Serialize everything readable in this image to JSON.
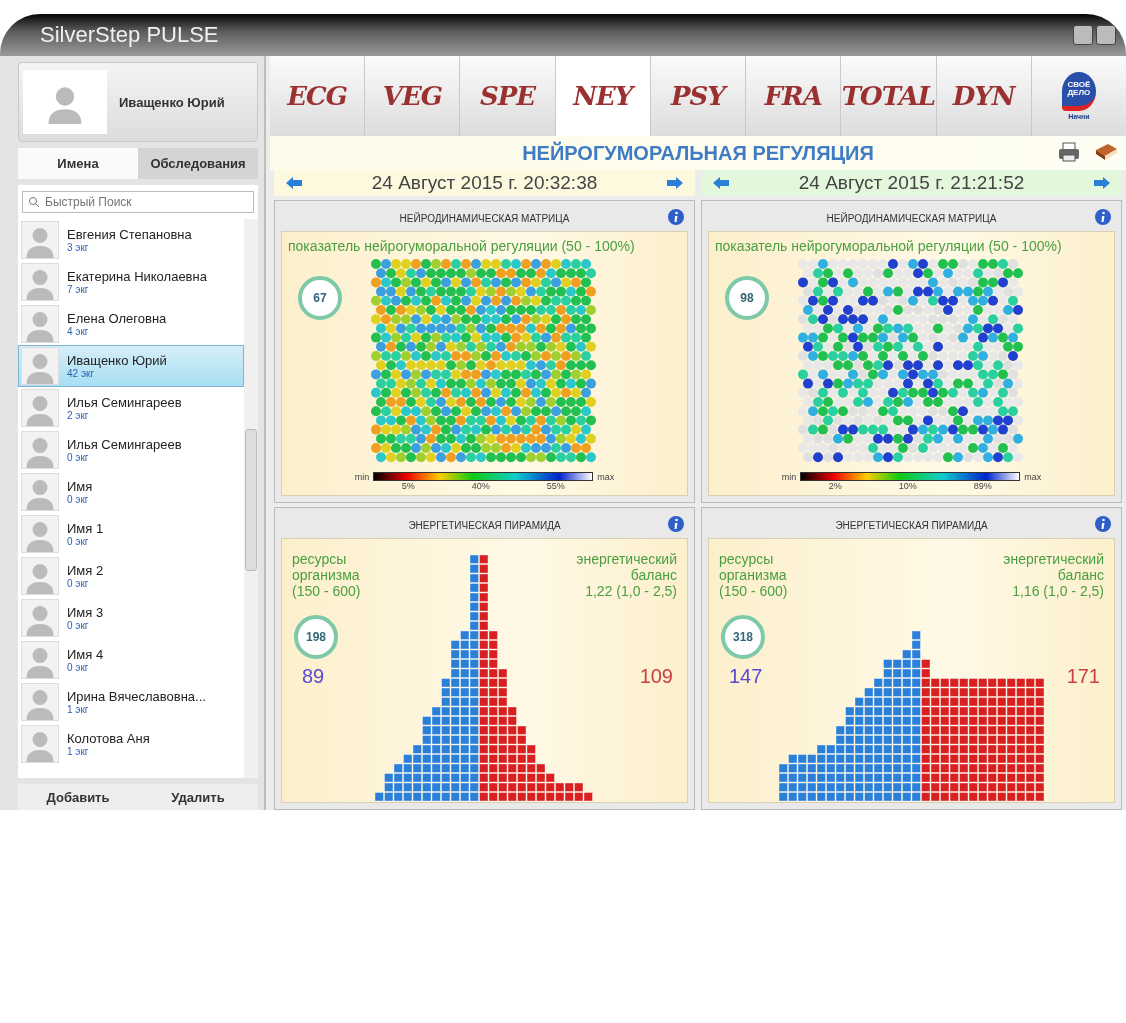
{
  "window": {
    "title": "SilverStep PULSE"
  },
  "profile": {
    "name": "Иващенко Юрий"
  },
  "sidebar_tabs": [
    {
      "label": "Имена",
      "selected": true
    },
    {
      "label": "Обследования",
      "selected": false
    }
  ],
  "search": {
    "placeholder": "Быстрый Поиск"
  },
  "patients": [
    {
      "name": "Евгения Степановна",
      "count": "3 экг",
      "selected": false
    },
    {
      "name": "Екатерина Николаевна",
      "count": "7 экг",
      "selected": false
    },
    {
      "name": "Елена Олеговна",
      "count": "4 экг",
      "selected": false
    },
    {
      "name": "Иващенко Юрий",
      "count": "42 экг",
      "selected": true
    },
    {
      "name": "Илья Семингареев",
      "count": "2 экг",
      "selected": false
    },
    {
      "name": "Илья Семингареев",
      "count": "0 экг",
      "selected": false
    },
    {
      "name": "Имя",
      "count": "0 экг",
      "selected": false
    },
    {
      "name": "Имя 1",
      "count": "0 экг",
      "selected": false
    },
    {
      "name": "Имя 2",
      "count": "0 экг",
      "selected": false
    },
    {
      "name": "Имя 3",
      "count": "0 экг",
      "selected": false
    },
    {
      "name": "Имя 4",
      "count": "0 экг",
      "selected": false
    },
    {
      "name": "Ирина Вячеславовна...",
      "count": "1 экг",
      "selected": false
    },
    {
      "name": "Колотова Аня",
      "count": "1 экг",
      "selected": false
    }
  ],
  "footer_buttons": [
    "Добавить",
    "Удалить"
  ],
  "tabs": [
    {
      "label": "ECG",
      "selected": false
    },
    {
      "label": "VEG",
      "selected": false
    },
    {
      "label": "SPE",
      "selected": false
    },
    {
      "label": "NEY",
      "selected": true
    },
    {
      "label": "PSY",
      "selected": false
    },
    {
      "label": "FRA",
      "selected": false
    },
    {
      "label": "TOTAL",
      "selected": false
    },
    {
      "label": "DYN",
      "selected": false
    }
  ],
  "logo": {
    "line1": "СВОЁ",
    "line2": "ДЕЛО",
    "caption": "Начни"
  },
  "heading": "НЕЙРОГУМОРАЛЬНАЯ РЕГУЛЯЦИЯ",
  "sessions": [
    {
      "date": "24 Август 2015 г. 20:32:38",
      "matrix": {
        "title": "НЕЙРОДИНАМИЧЕСКАЯ МАТРИЦА",
        "subtitle": "показатель нейрогуморальной регуляции (50 - 100%)",
        "score": "67",
        "scale_min": "min",
        "scale_max": "max",
        "scale_ticks": [
          "5%",
          "40%",
          "55%"
        ]
      },
      "pyramid": {
        "title": "ЭНЕРГЕТИЧЕСКАЯ ПИРАМИДА",
        "left_label": "ресурсы\nорганизма\n(150 - 600)",
        "right_label": "энергетический\nбаланс\n1,22 (1,0 - 2,5)",
        "score": "198",
        "left_value": "89",
        "right_value": "109"
      }
    },
    {
      "date": "24 Август 2015 г. 21:21:52",
      "matrix": {
        "title": "НЕЙРОДИНАМИЧЕСКАЯ МАТРИЦА",
        "subtitle": "показатель нейрогуморальной регуляции (50 - 100%)",
        "score": "98",
        "scale_min": "min",
        "scale_max": "max",
        "scale_ticks": [
          "2%",
          "10%",
          "89%"
        ]
      },
      "pyramid": {
        "title": "ЭНЕРГЕТИЧЕСКАЯ ПИРАМИДА",
        "left_label": "ресурсы\nорганизма\n(150 - 600)",
        "right_label": "энергетический\nбаланс\n1,16 (1,0 - 2,5)",
        "score": "318",
        "left_value": "147",
        "right_value": "171"
      }
    }
  ]
}
